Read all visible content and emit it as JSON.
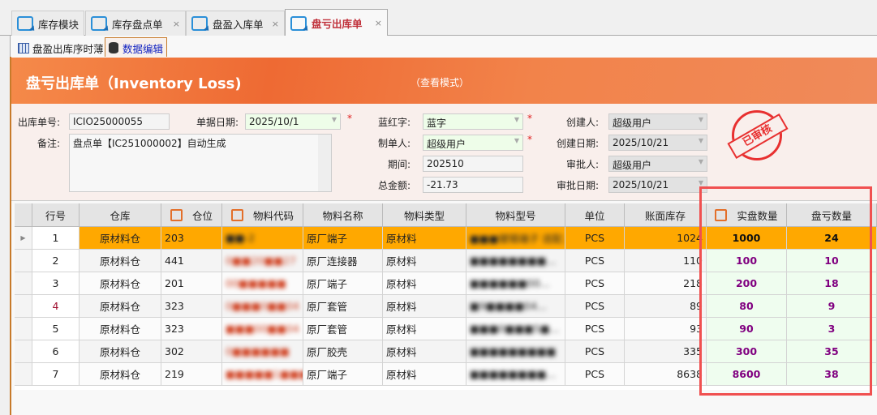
{
  "tabs": [
    {
      "label": "库存模块",
      "closable": false
    },
    {
      "label": "库存盘点单",
      "closable": true
    },
    {
      "label": "盘盈入库单",
      "closable": true
    },
    {
      "label": "盘亏出库单",
      "closable": true,
      "active": true
    }
  ],
  "close_glyph": "×",
  "subtabs": [
    {
      "label": "盘盈出库序时薄",
      "icon": "grid-icon"
    },
    {
      "label": "数据编辑",
      "icon": "database-icon",
      "active": true
    }
  ],
  "banner": {
    "title": "盘亏出库单（Inventory Loss)",
    "mode": "（查看模式）"
  },
  "form": {
    "doc_no_label": "出库单号:",
    "doc_no": "ICIO25000055",
    "doc_date_label": "单据日期:",
    "doc_date": "2025/10/1",
    "remark_label": "备注:",
    "remark": "盘点单【IC251000002】自动生成",
    "red_blue_label": "蓝红字:",
    "red_blue": "蓝字",
    "maker_label": "制单人:",
    "maker": "超级用户",
    "period_label": "期间:",
    "period": "202510",
    "total_label": "总金额:",
    "total": "-21.73",
    "creator_label": "创建人:",
    "creator": "超级用户",
    "create_date_label": "创建日期:",
    "create_date": "2025/10/21",
    "approver_label": "审批人:",
    "approver": "超级用户",
    "approve_date_label": "审批日期:",
    "approve_date": "2025/10/21",
    "required_mark": "*"
  },
  "stamp": "已审核",
  "grid": {
    "columns": [
      "行号",
      "仓库",
      "仓位",
      "物料代码",
      "物料名称",
      "物料类型",
      "物料型号",
      "单位",
      "账面库存",
      "实盘数量",
      "盘亏数量"
    ],
    "rows": [
      {
        "no": "1",
        "wh": "原材料仓",
        "loc": "203",
        "code": "■■-2",
        "name": "原厂端子",
        "type": "原材料",
        "model": "■■■镀锡端子 适配...",
        "unit": "PCS",
        "book": "1024",
        "actual": "1000",
        "loss": "24"
      },
      {
        "no": "2",
        "wh": "原材料仓",
        "loc": "441",
        "code": "0■■20■■27",
        "name": "原厂连接器",
        "type": "原材料",
        "model": "■■■■■■■■...",
        "unit": "PCS",
        "book": "110",
        "actual": "100",
        "loss": "10"
      },
      {
        "no": "3",
        "wh": "原材料仓",
        "loc": "201",
        "code": "00■■■■■",
        "name": "原厂端子",
        "type": "原材料",
        "model": "■■■■■■00...",
        "unit": "PCS",
        "book": "218",
        "actual": "200",
        "loss": "18"
      },
      {
        "no": "4",
        "wh": "原材料仓",
        "loc": "323",
        "code": "0■■■0■■04",
        "name": "原厂套管",
        "type": "原材料",
        "model": "■9■■■■04...",
        "unit": "PCS",
        "book": "89",
        "actual": "80",
        "loss": "9"
      },
      {
        "no": "5",
        "wh": "原材料仓",
        "loc": "323",
        "code": "■■■00■■04",
        "name": "原厂套管",
        "type": "原材料",
        "model": "■■■0■■■5■...",
        "unit": "PCS",
        "book": "93",
        "actual": "90",
        "loss": "3"
      },
      {
        "no": "6",
        "wh": "原材料仓",
        "loc": "302",
        "code": "0■■■■■■",
        "name": "原厂胶壳",
        "type": "原材料",
        "model": "■■■■■■■■■",
        "unit": "PCS",
        "book": "335",
        "actual": "300",
        "loss": "35"
      },
      {
        "no": "7",
        "wh": "原材料仓",
        "loc": "219",
        "code": "■■■■■1■■■",
        "name": "原厂端子",
        "type": "原材料",
        "model": "■■■■■■■■...",
        "unit": "PCS",
        "book": "8638",
        "actual": "8600",
        "loss": "38"
      }
    ]
  }
}
